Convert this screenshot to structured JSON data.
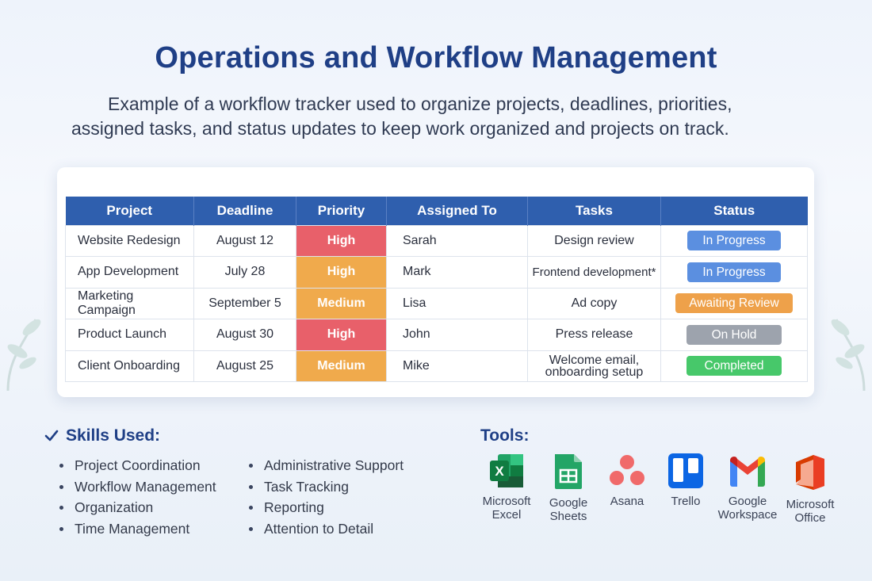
{
  "header": {
    "title": "Operations and Workflow Management",
    "subtitle": "Example of a workflow tracker used to organize projects, deadlines, priorities, assigned tasks, and status updates to keep work organized and projects on track."
  },
  "table": {
    "columns": [
      "Project",
      "Deadline",
      "Priority",
      "Assigned To",
      "Tasks",
      "Status"
    ],
    "rows": [
      {
        "project": "Website Redesign",
        "deadline": "August 12",
        "priority": "High",
        "assigned": "Sarah",
        "tasks": "Design review",
        "status": "In Progress"
      },
      {
        "project": "App Development",
        "deadline": "July 28",
        "priority": "High",
        "assigned": "Mark",
        "tasks": "Frontend development*",
        "status": "In Progress"
      },
      {
        "project": "Marketing Campaign",
        "deadline": "September 5",
        "priority": "Medium",
        "assigned": "Lisa",
        "tasks": "Ad copy",
        "status": "Awaiting Review"
      },
      {
        "project": "Product Launch",
        "deadline": "August 30",
        "priority": "High",
        "assigned": "John",
        "tasks": "Press release",
        "status": "On Hold"
      },
      {
        "project": "Client Onboarding",
        "deadline": "August 25",
        "priority": "Medium",
        "assigned": "Mike",
        "tasks_line1": "Welcome email,",
        "tasks_line2": "onboarding setup",
        "status": "Completed"
      }
    ]
  },
  "skills": {
    "heading": "Skills Used:",
    "col1": [
      "Project Coordination",
      "Workflow Management",
      "Organization",
      "Time Management"
    ],
    "col2": [
      "Administrative Support",
      "Task Tracking",
      "Reporting",
      "Attention to Detail"
    ]
  },
  "tools": {
    "heading": "Tools:",
    "items": [
      {
        "label": "Microsoft\nExcel",
        "icon": "excel-icon"
      },
      {
        "label": "Google\nSheets",
        "icon": "google-sheets-icon"
      },
      {
        "label": "Asana",
        "icon": "asana-icon"
      },
      {
        "label": "Trello",
        "icon": "trello-icon"
      },
      {
        "label": "Google\nWorkspace",
        "icon": "gmail-icon"
      },
      {
        "label": "Microsoft\nOffice",
        "icon": "office-icon"
      }
    ]
  },
  "colors": {
    "title": "#1f3f86",
    "table_header": "#2f5fae",
    "priority_high": "#e8606a",
    "priority_medium": "#f0aa4c",
    "status_in_progress": "#5b8fe0",
    "status_awaiting_review": "#eea14a",
    "status_on_hold": "#9da3ad",
    "status_completed": "#47c86a"
  }
}
